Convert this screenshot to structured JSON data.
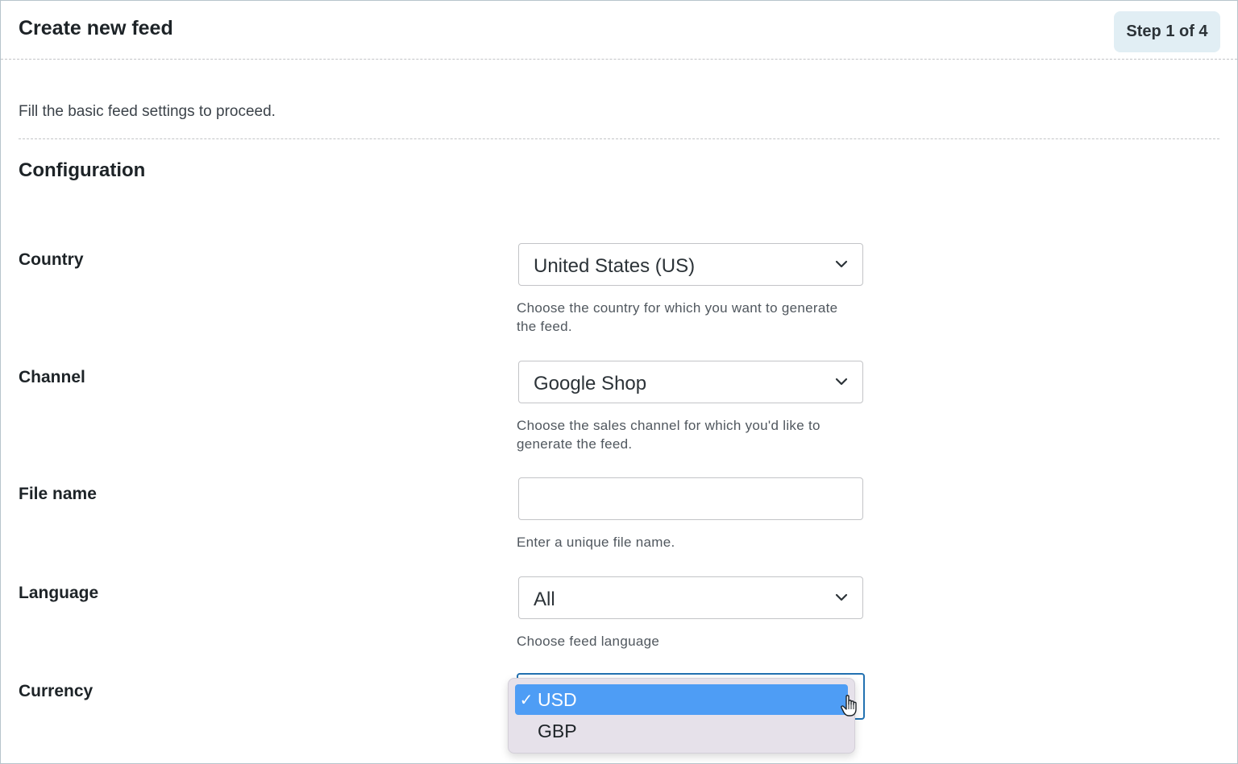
{
  "header": {
    "title": "Create new feed",
    "step_badge": "Step 1 of 4"
  },
  "intro_text": "Fill the basic feed settings to proceed.",
  "section_title": "Configuration",
  "fields": {
    "country": {
      "label": "Country",
      "value": "United States (US)",
      "help": "Choose the country for which you want to generate the feed."
    },
    "channel": {
      "label": "Channel",
      "value": "Google Shop",
      "help": "Choose the sales channel for which you'd like to generate the feed."
    },
    "file_name": {
      "label": "File name",
      "value": "",
      "help": "Enter a unique file name."
    },
    "language": {
      "label": "Language",
      "value": "All",
      "help": "Choose feed language"
    },
    "currency": {
      "label": "Currency",
      "options": [
        {
          "label": "USD",
          "check": "✓",
          "selected": true
        },
        {
          "label": "GBP",
          "selected": false
        }
      ]
    }
  },
  "colors": {
    "accent": "#2271b1",
    "selected_option": "#4e9df5",
    "badge_bg": "#e1eef4"
  },
  "icons": {
    "select_arrow": "chevron-down-icon",
    "cursor": "hand-pointer-icon"
  }
}
